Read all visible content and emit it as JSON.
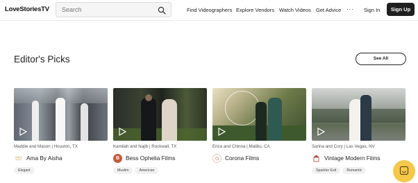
{
  "header": {
    "logo": "LoveStoriesTV",
    "search_placeholder": "Search",
    "nav": [
      "Find Videographers",
      "Explore Vendors",
      "Watch Videos",
      "Get Advice"
    ],
    "more": "···",
    "sign_in": "Sign In",
    "sign_up": "Sign Up"
  },
  "section": {
    "title": "Editor's Picks",
    "see_all": "See All"
  },
  "cards": [
    {
      "caption": "Maddie and Mason | Houston, TX",
      "vendor": "Ama By Aisha",
      "tags": [
        "Elegant"
      ]
    },
    {
      "caption": "Kamilah and Najib | Rockwall, TX",
      "vendor": "Bess Ophelia Films",
      "vendor_initial": "B",
      "tags": [
        "Muslim",
        "American"
      ]
    },
    {
      "caption": "Erica and Chinna | Malibu, CA",
      "vendor": "Corona Films",
      "tags": []
    },
    {
      "caption": "Sarina and Cory | Las Vegas, NV",
      "vendor": "Vintage Modern Films",
      "tags": [
        "Sparkler Exit",
        "Romantic"
      ]
    }
  ],
  "icons": {
    "search": "search-icon",
    "play": "play-icon",
    "chat": "chat-icon"
  },
  "colors": {
    "sign_up_bg": "#1f1f1f",
    "chat_bg": "#f5c84a",
    "vendor_b_bg": "#c65a3a"
  }
}
